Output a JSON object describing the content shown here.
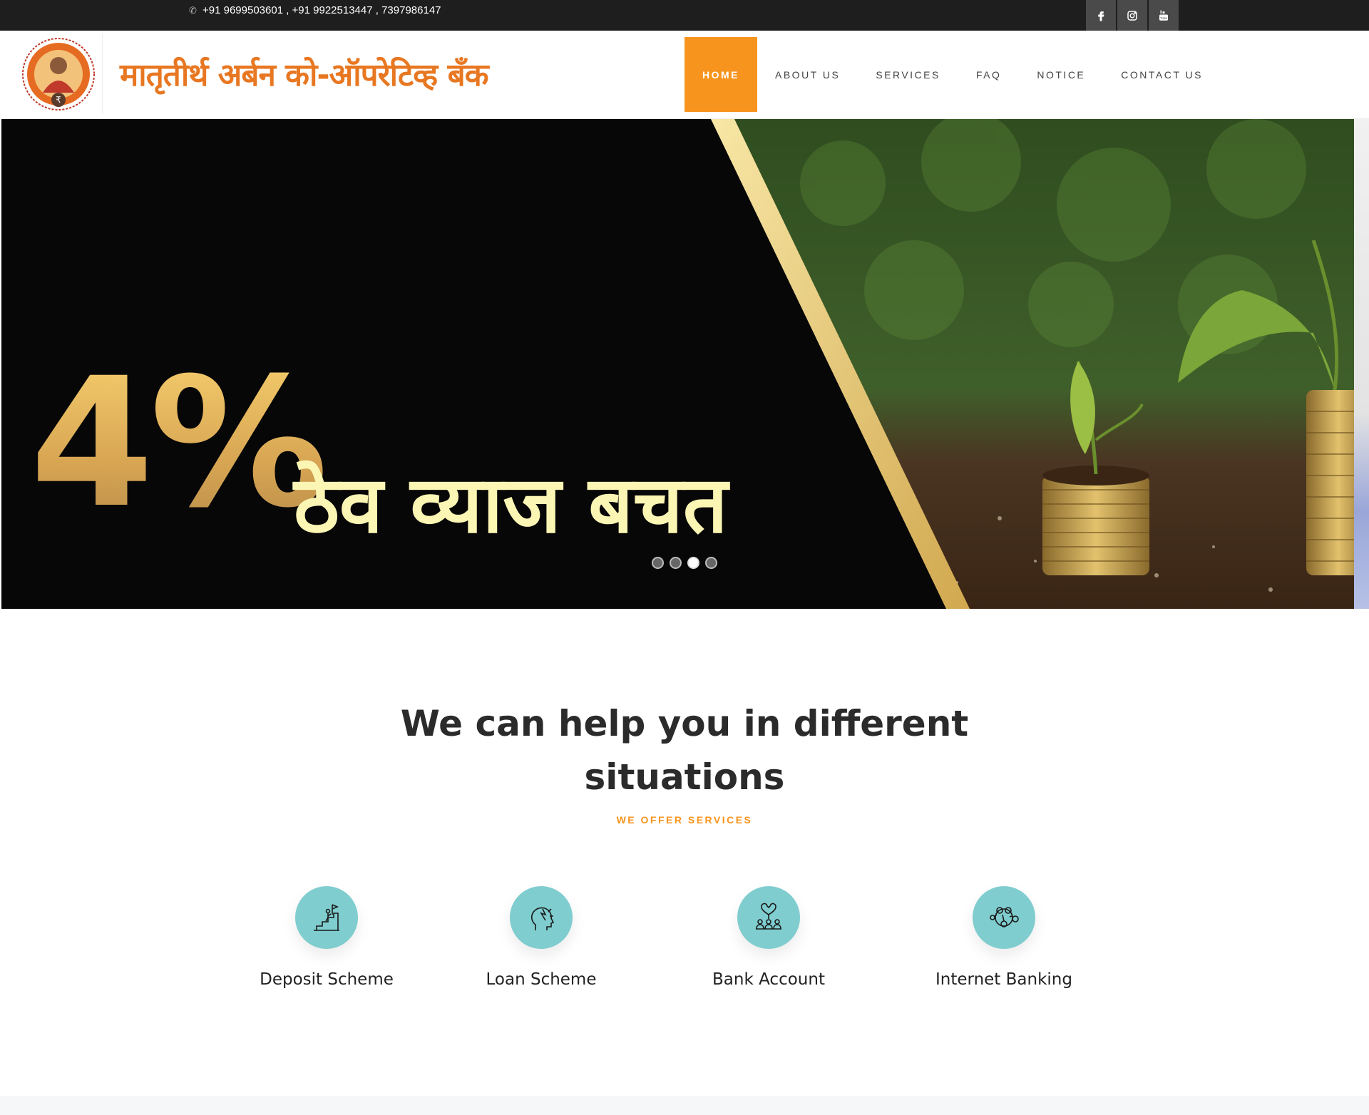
{
  "topbar": {
    "phone_icon": "phone-icon",
    "phone_text": "+91 9699503601 , +91 9922513447 , 7397986147",
    "social": [
      {
        "name": "facebook",
        "icon": "facebook-icon"
      },
      {
        "name": "instagram",
        "icon": "instagram-icon"
      },
      {
        "name": "youtube",
        "icon": "youtube-icon"
      }
    ]
  },
  "header": {
    "brand": "मातृतीर्थ अर्बन को-ऑपरेटिव्ह बँक",
    "brand_color": "#e87722",
    "nav": [
      {
        "label": "HOME",
        "active": true
      },
      {
        "label": "ABOUT US",
        "active": false
      },
      {
        "label": "SERVICES",
        "active": false
      },
      {
        "label": "FAQ",
        "active": false
      },
      {
        "label": "NOTICE",
        "active": false
      },
      {
        "label": "CONTACT US",
        "active": false
      }
    ],
    "active_color": "#f7941d"
  },
  "hero": {
    "rate": "4%",
    "tagline": "ठेव व्याज बचत",
    "slides": 4,
    "active_slide": 3
  },
  "services": {
    "title": "We can help you in different situations",
    "subtitle": "WE OFFER SERVICES",
    "items": [
      {
        "label": "Deposit Scheme",
        "icon": "growth-stairs-icon"
      },
      {
        "label": "Loan Scheme",
        "icon": "head-idea-icon"
      },
      {
        "label": "Bank Account",
        "icon": "team-heart-icon"
      },
      {
        "label": "Internet Banking",
        "icon": "network-people-icon"
      }
    ],
    "icon_bg": "#7fcdcf"
  }
}
